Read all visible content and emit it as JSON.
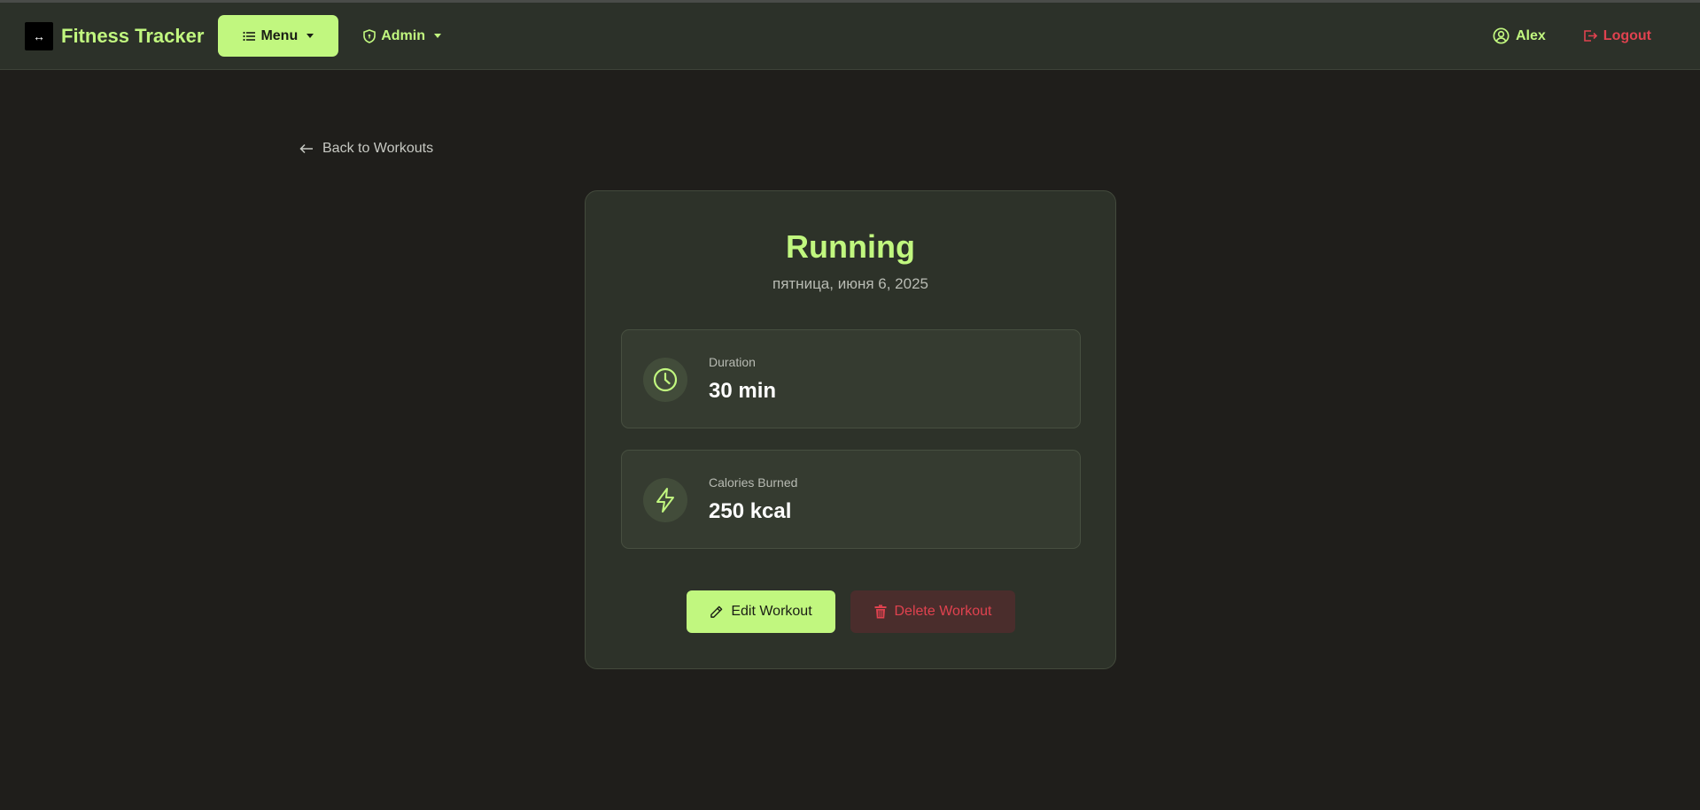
{
  "navbar": {
    "brand_logo_text": "↔",
    "brand_title": "Fitness Tracker",
    "menu_label": "Menu",
    "admin_label": "Admin",
    "user_name": "Alex",
    "logout_label": "Logout"
  },
  "back_link": {
    "label": "Back to Workouts"
  },
  "workout": {
    "title": "Running",
    "date": "пятница, июня 6, 2025",
    "stats": [
      {
        "label": "Duration",
        "value": "30 min",
        "icon": "clock-icon"
      },
      {
        "label": "Calories Burned",
        "value": "250 kcal",
        "icon": "lightning-icon"
      }
    ]
  },
  "actions": {
    "edit_label": "Edit Workout",
    "delete_label": "Delete Workout"
  },
  "colors": {
    "accent": "#c1f77f",
    "danger": "#e0424f",
    "background": "#1f1e1b",
    "navbar": "#2c3129",
    "card": "#2d3229"
  }
}
